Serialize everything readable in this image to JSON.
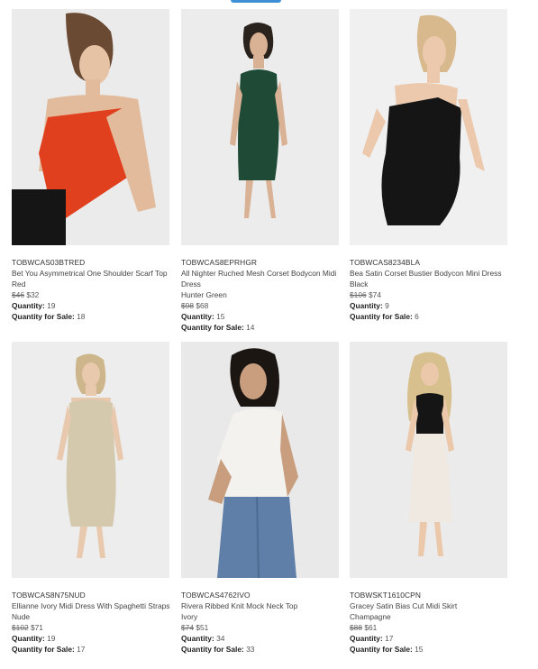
{
  "products": [
    {
      "sku": "TOBWCAS03BTRED",
      "name": "Bet You Asymmetrical One Shoulder Scarf Top",
      "color": "Red",
      "old_price": "$46",
      "price": "$32",
      "quantity": "19",
      "quantity_for_sale": "18"
    },
    {
      "sku": "TOBWCAS8EPRHGR",
      "name": "All Nighter Ruched Mesh Corset Bodycon Midi Dress",
      "color": "Hunter Green",
      "old_price": "$98",
      "price": "$68",
      "quantity": "15",
      "quantity_for_sale": "14"
    },
    {
      "sku": "TOBWCAS8234BLA",
      "name": "Bea Satin Corset Bustier Bodycon Mini Dress",
      "color": "Black",
      "old_price": "$106",
      "price": "$74",
      "quantity": "9",
      "quantity_for_sale": "6"
    },
    {
      "sku": "TOBWCAS8N75NUD",
      "name": "Ellianne Ivory Midi Dress With Spaghetti Straps",
      "color": "Nude",
      "old_price": "$102",
      "price": "$71",
      "quantity": "19",
      "quantity_for_sale": "17"
    },
    {
      "sku": "TOBWCAS4762IVO",
      "name": "Rivera Ribbed Knit Mock Neck Top",
      "color": "Ivory",
      "old_price": "$74",
      "price": "$51",
      "quantity": "34",
      "quantity_for_sale": "33"
    },
    {
      "sku": "TOBWSKT1610CPN",
      "name": "Gracey Satin Bias Cut Midi Skirt",
      "color": "Champagne",
      "old_price": "$88",
      "price": "$61",
      "quantity": "17",
      "quantity_for_sale": "15"
    }
  ],
  "labels": {
    "quantity": "Quantity:",
    "quantity_for_sale": "Quantity for Sale:"
  },
  "colors": {
    "accent_tab": "#3d8fd6",
    "photo_bg": "#ececec",
    "red_top": "#e1401f",
    "green_dress": "#1e4a36",
    "black_dress": "#151515",
    "nude_dress": "#d4c8ad",
    "ivory_top": "#f4f2ef",
    "champagne_skirt": "#efe9e1"
  }
}
